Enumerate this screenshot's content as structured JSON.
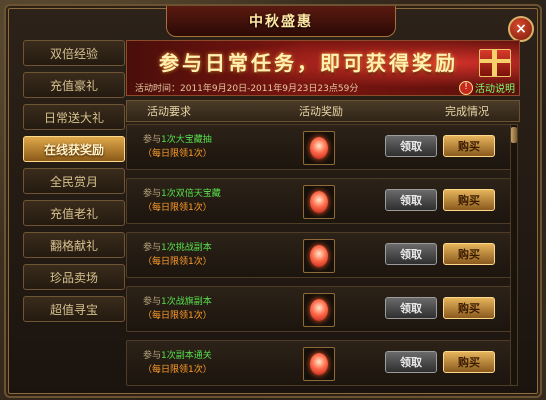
{
  "window": {
    "title": "中秋盛惠",
    "close_label": "×"
  },
  "sidebar": {
    "items": [
      {
        "label": "双倍经验",
        "active": false
      },
      {
        "label": "充值豪礼",
        "active": false
      },
      {
        "label": "日常送大礼",
        "active": false
      },
      {
        "label": "在线获奖励",
        "active": true
      },
      {
        "label": "全民赏月",
        "active": false
      },
      {
        "label": "充值老礼",
        "active": false
      },
      {
        "label": "翻格献礼",
        "active": false
      },
      {
        "label": "珍品卖场",
        "active": false
      },
      {
        "label": "超值寻宝",
        "active": false
      }
    ]
  },
  "banner": {
    "title": "参与日常任务，即可获得奖励",
    "time_text": "活动时间：2011年9月20日-2011年9月23日23点59分",
    "tip_label": "活动说明"
  },
  "table": {
    "col_requirement": "活动要求",
    "col_reward": "活动奖励",
    "col_status": "完成情况"
  },
  "rows": [
    {
      "req_prefix": "参与",
      "req_task": "1次大宝藏抽",
      "limit": "（每日限领1次）",
      "claim": "领取",
      "buy": "购买"
    },
    {
      "req_prefix": "参与",
      "req_task": "1次双倍天宝藏",
      "limit": "（每日限领1次）",
      "claim": "领取",
      "buy": "购买"
    },
    {
      "req_prefix": "参与",
      "req_task": "1次挑战副本",
      "limit": "（每日限领1次）",
      "claim": "领取",
      "buy": "购买"
    },
    {
      "req_prefix": "参与",
      "req_task": "1次战旗副本",
      "limit": "（每日限领1次）",
      "claim": "领取",
      "buy": "购买"
    },
    {
      "req_prefix": "参与",
      "req_task": "1次副本通关",
      "limit": "（每日限领1次）",
      "claim": "领取",
      "buy": "购买"
    }
  ]
}
